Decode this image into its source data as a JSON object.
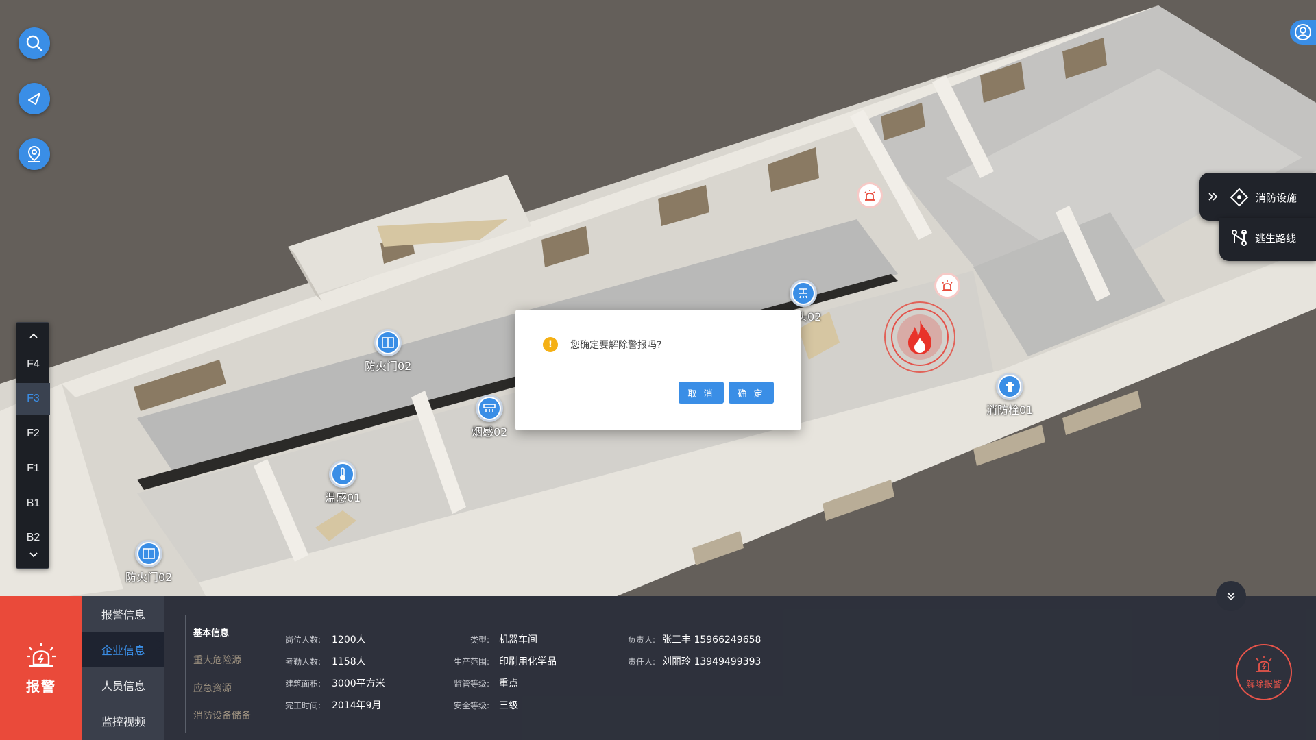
{
  "colors": {
    "accent": "#3a8ee6",
    "alarm": "#ea4a3a",
    "panel": "#2b2f3a",
    "scene_bg": "#645f5a"
  },
  "toolbar": {
    "search_icon": "search-icon",
    "compass_icon": "compass-icon",
    "location_icon": "location-pin-icon",
    "user_icon": "user-icon"
  },
  "floors": {
    "items": [
      "F4",
      "F3",
      "F2",
      "F1",
      "B1",
      "B2"
    ],
    "active": "F3"
  },
  "side_panel": {
    "fire_facilities": "消防设施",
    "escape_route": "逃生路线"
  },
  "markers": {
    "fire_door_a": "防火门02",
    "smoke_sensor": "烟感02",
    "temp_sensor": "温感01",
    "fire_door_b": "防火门02",
    "sprinkler": "喷头02",
    "hydrant": "消防栓01"
  },
  "dialog": {
    "message": "您确定要解除警报吗?",
    "cancel": "取 消",
    "confirm": "确 定"
  },
  "bottom": {
    "alarm_tab": "报警",
    "nav": [
      "报警信息",
      "企业信息",
      "人员信息",
      "监控视频"
    ],
    "active_nav": "企业信息",
    "sub_nav": [
      "基本信息",
      "重大危险源",
      "应急资源",
      "消防设备储备"
    ],
    "fields": {
      "post_count_key": "岗位人数:",
      "post_count_val": "1200人",
      "attendance_key": "考勤人数:",
      "attendance_val": "1158人",
      "area_key": "建筑面积:",
      "area_val": "3000平方米",
      "completion_key": "完工时间:",
      "completion_val": "2014年9月",
      "type_key": "类型:",
      "type_val": "机器车间",
      "scope_key": "生产范围:",
      "scope_val": "印刷用化学品",
      "supervision_key": "监管等级:",
      "supervision_val": "重点",
      "safety_key": "安全等级:",
      "safety_val": "三级",
      "manager_key": "负责人:",
      "manager_val": "张三丰 15966249658",
      "responsible_key": "责任人:",
      "responsible_val": "刘丽玲 13949499393"
    },
    "release_alarm": "解除报警"
  }
}
